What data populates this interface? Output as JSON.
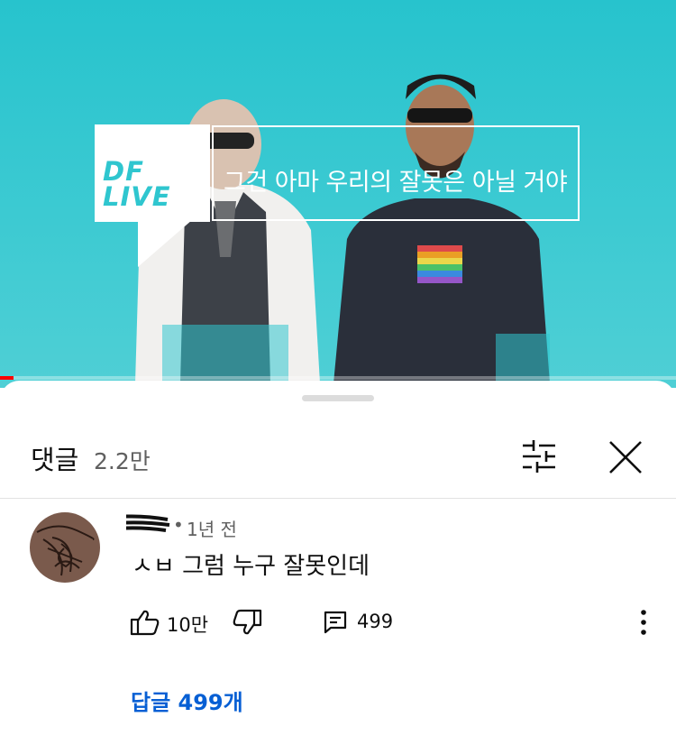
{
  "video": {
    "logo_line1": "DF",
    "logo_line2": "LIVE",
    "caption": "그건 아마 우리의 잘못은 아닐 거야",
    "progress_fraction": 0.02,
    "accent_color": "#ff0000",
    "background_color": "#2fc6cf"
  },
  "comments_panel": {
    "title": "댓글",
    "count": "2.2만",
    "filter_icon": "sort-filter-icon",
    "close_icon": "close-icon"
  },
  "comment": {
    "author_separator": "•",
    "time": "1년 전",
    "text": "ㅅㅂ 그럼 누구 잘못인데",
    "likes": "10만",
    "reply_count": "499",
    "replies_link": "답글 499개",
    "link_color": "#065fd4"
  }
}
